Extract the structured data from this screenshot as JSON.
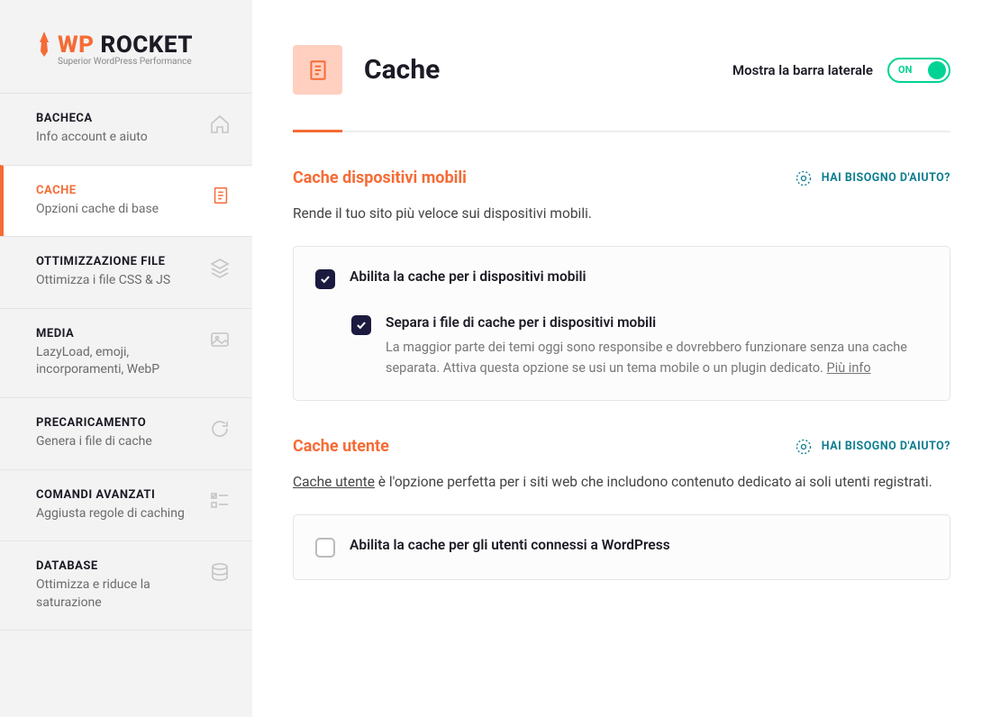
{
  "brand": {
    "name_prefix": "WP",
    "name_suffix": " ROCKET",
    "tagline": "Superior WordPress Performance"
  },
  "nav": [
    {
      "title": "BACHECA",
      "subtitle": "Info account e aiuto",
      "active": false
    },
    {
      "title": "CACHE",
      "subtitle": "Opzioni cache di base",
      "active": true
    },
    {
      "title": "OTTIMIZZAZIONE FILE",
      "subtitle": "Ottimizza i file CSS & JS",
      "active": false
    },
    {
      "title": "MEDIA",
      "subtitle": "LazyLoad, emoji, incorporamenti, WebP",
      "active": false
    },
    {
      "title": "PRECARICAMENTO",
      "subtitle": "Genera i file di cache",
      "active": false
    },
    {
      "title": "COMANDI AVANZATI",
      "subtitle": "Aggiusta regole di caching",
      "active": false
    },
    {
      "title": "DATABASE",
      "subtitle": "Ottimizza e riduce la saturazione",
      "active": false
    }
  ],
  "header": {
    "title": "Cache",
    "sidebar_label": "Mostra la barra laterale",
    "toggle_on": "ON"
  },
  "sections": {
    "mobile": {
      "title": "Cache dispositivi mobili",
      "help": "HAI BISOGNO D'AIUTO?",
      "desc": "Rende il tuo sito più veloce sui dispositivi mobili.",
      "opt1_label": "Abilita la cache per i dispositivi mobili",
      "opt2_label": "Separa i file di cache per i dispositivi mobili",
      "opt2_help": "La maggior parte dei temi oggi sono responsibe e dovrebbero funzionare senza una cache separata. Attiva questa opzione se usi un tema mobile o un plugin dedicato. ",
      "opt2_more": "Più info"
    },
    "user": {
      "title": "Cache utente",
      "help": "HAI BISOGNO D'AIUTO?",
      "desc_link": "Cache utente",
      "desc_rest": " è l'opzione perfetta per i siti web che includono contenuto dedicato ai soli utenti registrati.",
      "opt1_label": "Abilita la cache per gli utenti connessi a WordPress"
    }
  }
}
